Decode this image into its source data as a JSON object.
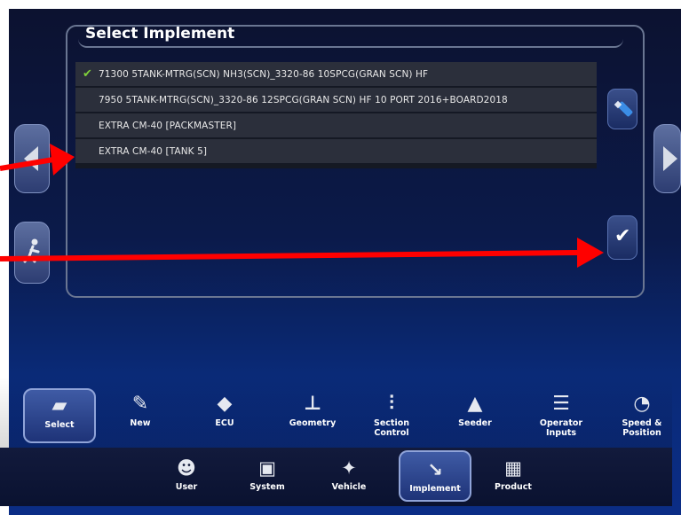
{
  "dialog": {
    "title": "Select Implement",
    "items": [
      {
        "label": "71300 5TANK-MTRG(SCN) NH3(SCN)_3320-86 10SPCG(GRAN SCN) HF",
        "selected": true
      },
      {
        "label": "7950 5TANK-MTRG(SCN)_3320-86 12SPCG(GRAN SCN) HF 10 PORT 2016+BOARD2018",
        "selected": false
      },
      {
        "label": "EXTRA CM-40 [PACKMASTER]",
        "selected": false
      },
      {
        "label": "EXTRA CM-40 [TANK 5]",
        "selected": false
      }
    ],
    "check_glyph": "✔",
    "confirm_glyph": "✔"
  },
  "toolbar": {
    "items": [
      {
        "label": "Select",
        "icon": "folder-icon"
      },
      {
        "label": "New",
        "icon": "new-icon"
      },
      {
        "label": "ECU",
        "icon": "ecu-icon"
      },
      {
        "label": "Geometry",
        "icon": "geometry-icon"
      },
      {
        "label": "Section\nControl",
        "icon": "section-control-icon"
      },
      {
        "label": "Seeder",
        "icon": "seeder-icon"
      },
      {
        "label": "Operator\nInputs",
        "icon": "operator-inputs-icon"
      },
      {
        "label": "Speed &\nPosition",
        "icon": "speed-position-icon"
      }
    ]
  },
  "bottom_nav": {
    "items": [
      {
        "label": "User",
        "icon": "user-icon"
      },
      {
        "label": "System",
        "icon": "system-icon"
      },
      {
        "label": "Vehicle",
        "icon": "vehicle-icon"
      },
      {
        "label": "Implement",
        "icon": "implement-icon"
      },
      {
        "label": "Product",
        "icon": "product-icon"
      }
    ]
  },
  "colors": {
    "annotation_arrow": "#ff0000",
    "check": "#7fcf3b"
  }
}
